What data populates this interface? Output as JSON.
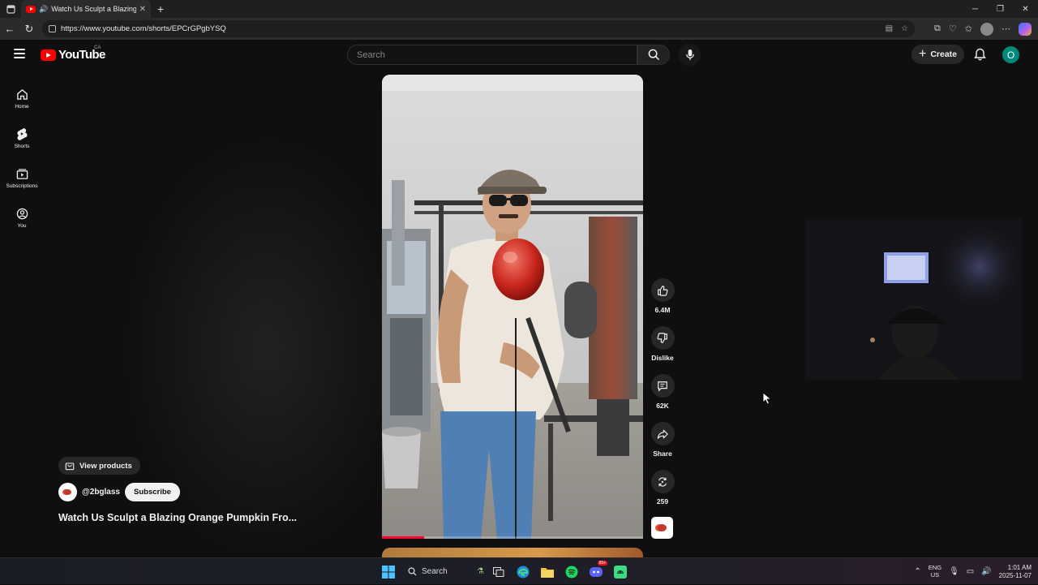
{
  "browser": {
    "tab_title": "Watch Us Sculpt a Blazing O",
    "url": "https://www.youtube.com/shorts/EPCrGPgbYSQ",
    "window_controls": [
      "minimize",
      "restore",
      "close"
    ]
  },
  "header": {
    "logo_text": "YouTube",
    "country_code": "CA",
    "search_placeholder": "Search",
    "create_label": "Create",
    "avatar_letter": "O"
  },
  "sidebar": {
    "items": [
      {
        "label": "Home",
        "icon": "home-icon"
      },
      {
        "label": "Shorts",
        "icon": "shorts-icon"
      },
      {
        "label": "Subscriptions",
        "icon": "subscriptions-icon"
      },
      {
        "label": "You",
        "icon": "you-icon"
      }
    ]
  },
  "short": {
    "title": "Watch Us Sculpt a Blazing Orange Pumpkin Fro...",
    "channel": "@2bglass",
    "subscribe_label": "Subscribe",
    "view_products_label": "View products",
    "progress": 0.16
  },
  "actions": {
    "likes": "6.4M",
    "dislike_label": "Dislike",
    "comments": "62K",
    "share_label": "Share",
    "remix": "259"
  },
  "taskbar": {
    "search_label": "Search",
    "lang_top": "ENG",
    "lang_bottom": "US",
    "time": "1:01 AM",
    "date": "2025-11-07",
    "discord_badge": "99+"
  },
  "colors": {
    "brand_red": "#ff0000",
    "progress_red": "#ff0033",
    "avatar_teal": "#00897b",
    "page_bg": "#0f0f0f"
  }
}
